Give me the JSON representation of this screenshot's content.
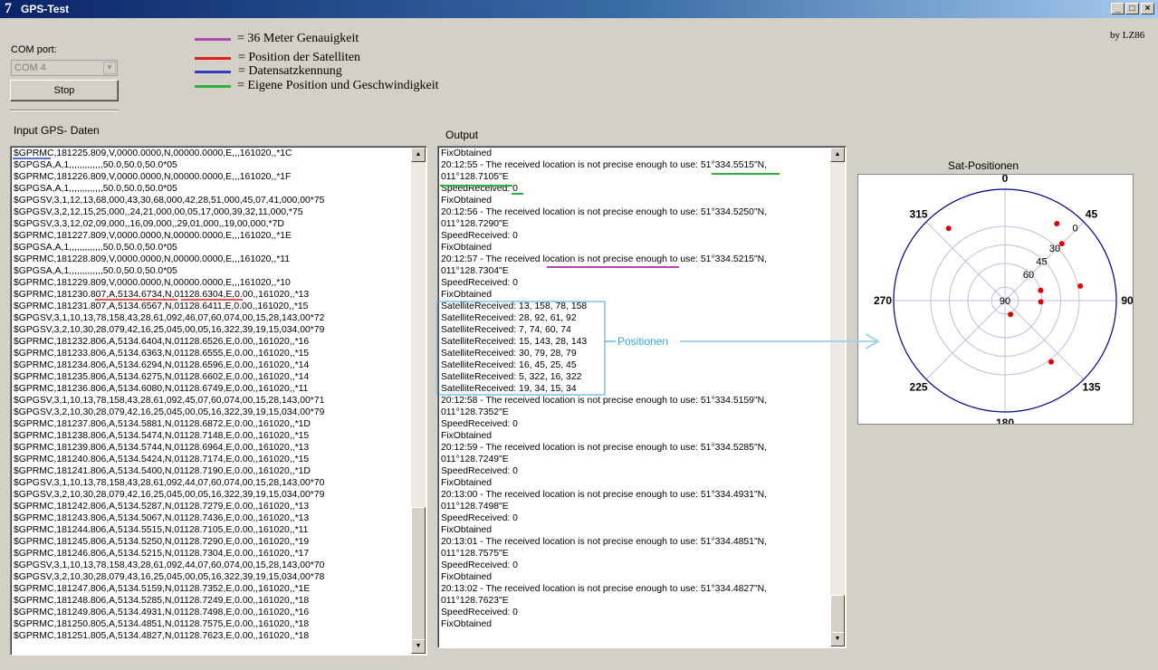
{
  "window": {
    "title": "GPS-Test",
    "minimize": "_",
    "maximize": "□",
    "close": "×",
    "icon": "app-icon-7",
    "icon_glyph": "7"
  },
  "author": "by LZ86",
  "com": {
    "label": "COM port:",
    "value": "COM 4",
    "arrow": "▼"
  },
  "stop_label": "Stop",
  "legend": [
    {
      "color": "#b048b0",
      "text": "= 36 Meter Genauigkeit"
    },
    {
      "color": "#e02020",
      "text": "=  Position der Satelliten"
    },
    {
      "color": "#3040c0",
      "text": "=  Datensatzkennung"
    },
    {
      "color": "#30b040",
      "text": "= Eigene Position und Geschwindigkeit"
    }
  ],
  "input_label": "Input GPS- Daten",
  "output_label": "Output",
  "sat_label": "Sat-Positionen",
  "positions_label": "Positionen",
  "scroll_up": "▲",
  "scroll_down": "▼",
  "input_lines": [
    "$GPRMC,181225.809,V,0000.0000,N,00000.0000,E,,,161020,,*1C",
    "$GPGSA,A,1,,,,,,,,,,,,,50.0,50.0,50.0*05",
    "$GPRMC,181226.809,V,0000.0000,N,00000.0000,E,,,161020,,*1F",
    "$GPGSA,A,1,,,,,,,,,,,,,50.0,50.0,50.0*05",
    "$GPGSV,3,1,12,13,68,000,43,30,68,000,42,28,51,000,45,07,41,000,00*75",
    "$GPGSV,3,2,12,15,25,000,,24,21,000,00,05,17,000,39,32,11,000,*75",
    "$GPGSV,3,3,12,02,09,000,,16,09,000,,29,01,000,,19,00,000,*7D",
    "$GPRMC,181227.809,V,0000.0000,N,00000.0000,E,,,161020,,*1E",
    "$GPGSA,A,1,,,,,,,,,,,,,50.0,50.0,50.0*05",
    "$GPRMC,181228.809,V,0000.0000,N,00000.0000,E,,,161020,,*11",
    "$GPGSA,A,1,,,,,,,,,,,,,50.0,50.0,50.0*05",
    "$GPRMC,181229.809,V,0000.0000,N,00000.0000,E,,,161020,,*10",
    "$GPRMC,181230.807,A,5134.6734,N,01128.6304,E,0.00,,161020,,*13",
    "$GPRMC,181231.807,A,5134.6567,N,01128.6411,E,0.00,,161020,,*15",
    "$GPGSV,3,1,10,13,78,158,43,28,61,092,46,07,60,074,00,15,28,143,00*72",
    "$GPGSV,3,2,10,30,28,079,42,16,25,045,00,05,16,322,39,19,15,034,00*79",
    "$GPRMC,181232.806,A,5134.6404,N,01128.6526,E,0.00,,161020,,*16",
    "$GPRMC,181233.806,A,5134.6363,N,01128.6555,E,0.00,,161020,,*15",
    "$GPRMC,181234.806,A,5134.6294,N,01128.6596,E,0.00,,161020,,*14",
    "$GPRMC,181235.806,A,5134.6275,N,01128.6602,E,0.00,,161020,,*14",
    "$GPRMC,181236.806,A,5134.6080,N,01128.6749,E,0.00,,161020,,*11",
    "$GPGSV,3,1,10,13,78,158,43,28,61,092,45,07,60,074,00,15,28,143,00*71",
    "$GPGSV,3,2,10,30,28,079,42,16,25,045,00,05,16,322,39,19,15,034,00*79",
    "$GPRMC,181237.806,A,5134.5881,N,01128.6872,E,0.00,,161020,,*1D",
    "$GPRMC,181238.806,A,5134.5474,N,01128.7148,E,0.00,,161020,,*15",
    "$GPRMC,181239.806,A,5134.5744,N,01128.6964,E,0.00,,161020,,*13",
    "$GPRMC,181240.806,A,5134.5424,N,01128.7174,E,0.00,,161020,,*15",
    "$GPRMC,181241.806,A,5134.5400,N,01128.7190,E,0.00,,161020,,*1D",
    "$GPGSV,3,1,10,13,78,158,43,28,61,092,44,07,60,074,00,15,28,143,00*70",
    "$GPGSV,3,2,10,30,28,079,42,16,25,045,00,05,16,322,39,19,15,034,00*79",
    "$GPRMC,181242.806,A,5134.5287,N,01128.7279,E,0.00,,161020,,*13",
    "$GPRMC,181243.806,A,5134.5067,N,01128.7436,E,0.00,,161020,,*13",
    "$GPRMC,181244.806,A,5134.5515,N,01128.7105,E,0.00,,161020,,*11",
    "$GPRMC,181245.806,A,5134.5250,N,01128.7290,E,0.00,,161020,,*19",
    "$GPRMC,181246.806,A,5134.5215,N,01128.7304,E,0.00,,161020,,*17",
    "$GPGSV,3,1,10,13,78,158,43,28,61,092,44,07,60,074,00,15,28,143,00*70",
    "$GPGSV,3,2,10,30,28,079,43,16,25,045,00,05,16,322,39,19,15,034,00*78",
    "$GPRMC,181247.806,A,5134.5159,N,01128.7352,E,0.00,,161020,,*1E",
    "$GPRMC,181248.806,A,5134.5285,N,01128.7249,E,0.00,,161020,,*18",
    "$GPRMC,181249.806,A,5134.4931,N,01128.7498,E,0.00,,161020,,*16",
    "$GPRMC,181250.805,A,5134.4851,N,01128.7575,E,0.00,,161020,,*18",
    "$GPRMC,181251.805,A,5134.4827,N,01128.7623,E,0.00,,161020,,*18"
  ],
  "output_lines": [
    "FixObtained",
    "20:12:55 - The received location is not precise enough to use: 51°334.5515\"N,",
    "011°128.7105\"E",
    "SpeedReceived: 0",
    "FixObtained",
    "20:12:56 - The received location is not precise enough to use: 51°334.5250\"N,",
    "011°128.7290\"E",
    "SpeedReceived: 0",
    "FixObtained",
    "20:12:57 - The received location is not precise enough to use: 51°334.5215\"N,",
    "011°128.7304\"E",
    "SpeedReceived: 0",
    "FixObtained",
    "SatelliteReceived: 13, 158, 78, 158",
    "SatelliteReceived: 28, 92, 61, 92",
    "SatelliteReceived: 7, 74, 60, 74",
    "SatelliteReceived: 15, 143, 28, 143",
    "SatelliteReceived: 30, 79, 28, 79",
    "SatelliteReceived: 16, 45, 25, 45",
    "SatelliteReceived: 5, 322, 16, 322",
    "SatelliteReceived: 19, 34, 15, 34",
    "20:12:58 - The received location is not precise enough to use: 51°334.5159\"N,",
    "011°128.7352\"E",
    "SpeedReceived: 0",
    "FixObtained",
    "20:12:59 - The received location is not precise enough to use: 51°334.5285\"N,",
    "011°128.7249\"E",
    "SpeedReceived: 0",
    "FixObtained",
    "20:13:00 - The received location is not precise enough to use: 51°334.4931\"N,",
    "011°128.7498\"E",
    "SpeedReceived: 0",
    "FixObtained",
    "20:13:01 - The received location is not precise enough to use: 51°334.4851\"N,",
    "011°128.7575\"E",
    "SpeedReceived: 0",
    "FixObtained",
    "20:13:02 - The received location is not precise enough to use: 51°334.4827\"N,",
    "011°128.7623\"E",
    "SpeedReceived: 0",
    "FixObtained"
  ],
  "chart_data": {
    "type": "scatter",
    "coordinate_system": "polar-azimuth-elevation",
    "azimuth_labels": [
      "0",
      "45",
      "90",
      "135",
      "180",
      "225",
      "270",
      "315"
    ],
    "elevation_labels": [
      "0",
      "30",
      "45",
      "60",
      "90"
    ],
    "ring_elevations": [
      0,
      30,
      45,
      60,
      90
    ],
    "satellites": [
      {
        "id": 13,
        "azimuth": 158,
        "elevation": 78
      },
      {
        "id": 28,
        "azimuth": 92,
        "elevation": 61
      },
      {
        "id": 7,
        "azimuth": 74,
        "elevation": 60
      },
      {
        "id": 15,
        "azimuth": 143,
        "elevation": 28
      },
      {
        "id": 30,
        "azimuth": 79,
        "elevation": 28
      },
      {
        "id": 16,
        "azimuth": 45,
        "elevation": 25
      },
      {
        "id": 5,
        "azimuth": 322,
        "elevation": 16
      },
      {
        "id": 19,
        "azimuth": 34,
        "elevation": 15
      }
    ],
    "point_color": "#e00000",
    "outer_circle_color": "#00008b",
    "grid_color": "#c8b8e0"
  }
}
